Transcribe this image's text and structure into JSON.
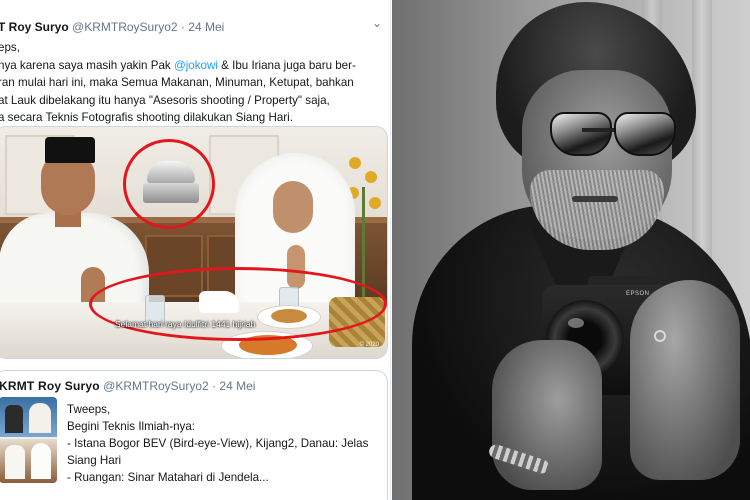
{
  "tweet1": {
    "name": "T Roy Suryo",
    "handle": "@KRMTRoySuryo2",
    "separator": "·",
    "date": "24 Mei",
    "caret": "⌄",
    "lines": [
      {
        "pre": "eps,",
        "mention": "",
        "post": ""
      },
      {
        "pre": "nya karena saya masih yakin Pak ",
        "mention": "@jokowi",
        "post": " & Ibu Iriana juga baru ber-"
      },
      {
        "pre": "ran mulai hari ini, maka Semua Makanan, Minuman, Ketupat, bahkan",
        "mention": "",
        "post": ""
      },
      {
        "pre": "at Lauk dibelakang itu hanya \"Asesoris shooting / Property\" saja,",
        "mention": "",
        "post": ""
      },
      {
        "pre": "a secara Teknis Fotografis shooting dilakukan Siang Hari.",
        "mention": "",
        "post": ""
      }
    ],
    "photo": {
      "caption": "Selamat hari raya Idulfitri 1441 hijriah",
      "copyright": "© 2020",
      "annotation_color": "#e3161b"
    }
  },
  "tweet2": {
    "name": "KRMT Roy Suryo",
    "handle": "@KRMTRoySuryo2",
    "separator": "·",
    "date": "24 Mei",
    "lines": [
      "Tweeps,",
      "Begini Teknis Ilmiah-nya:",
      "- Istana Bogor BEV (Bird-eye-View), Kijang2, Danau: Jelas",
      "Siang Hari",
      "- Ruangan: Sinar Matahari di Jendela..."
    ]
  },
  "portrait": {
    "camera_brand": "EPSON"
  },
  "colors": {
    "link": "#1da1f2",
    "text": "#14171a",
    "muted": "#657786",
    "border": "#ccd6dd"
  }
}
